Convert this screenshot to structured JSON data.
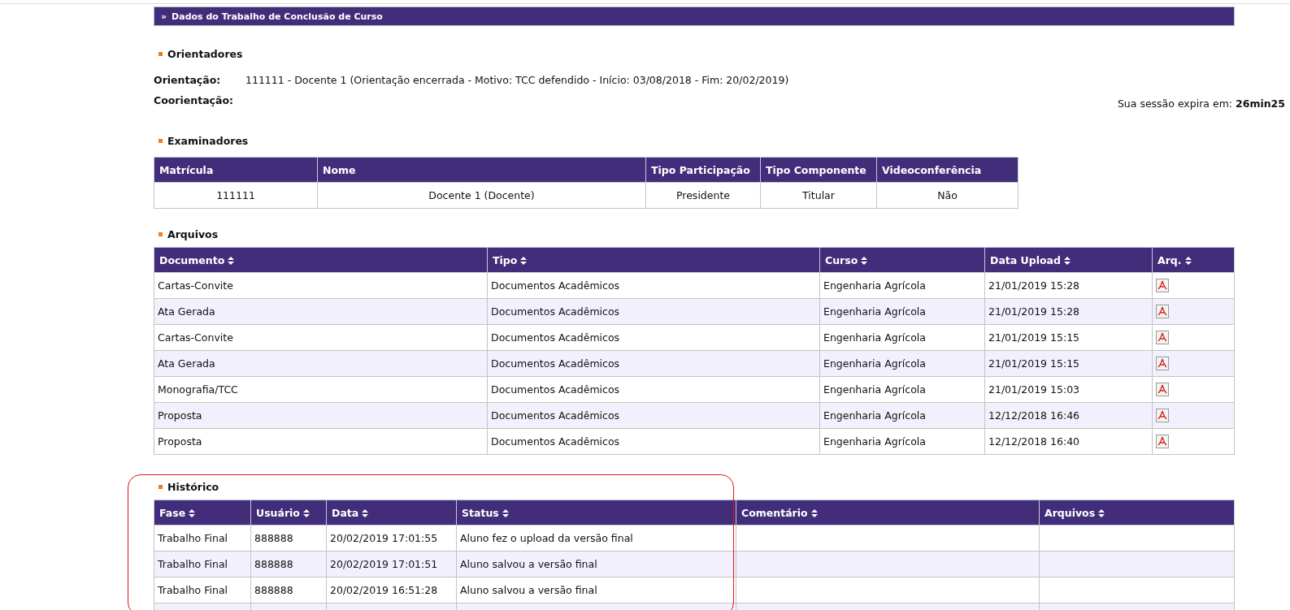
{
  "banner": {
    "marker": "»",
    "title": "Dados do Trabalho de Conclusão de Curso"
  },
  "session": {
    "text": "Sua sessão expira em: **26min25**"
  },
  "orientadores": {
    "title": "Orientadores",
    "fields": [
      {
        "label": "Orientação:",
        "value": "111111 - Docente 1 (Orientação encerrada - Motivo: TCC defendido - Início: 03/08/2018 - Fim: 20/02/2019)"
      },
      {
        "label": "Coorientação:"
      }
    ]
  },
  "examinadores": {
    "title": "Examinadores",
    "columns": [
      {
        "label": "Matrícula",
        "sortable": false
      },
      {
        "label": "Nome",
        "sortable": false
      },
      {
        "label": "Tipo Participação",
        "sortable": false
      },
      {
        "label": "Tipo Componente",
        "sortable": false
      },
      {
        "label": "Videoconferência",
        "sortable": false
      }
    ],
    "rows": [
      {
        "cells": [
          "111111",
          "Docente 1 (Docente)",
          "Presidente",
          "Titular",
          "Não"
        ]
      }
    ]
  },
  "arquivos": {
    "title": "Arquivos",
    "columns": [
      {
        "label": "Documento",
        "sortable": true
      },
      {
        "label": "Tipo",
        "sortable": true
      },
      {
        "label": "Curso",
        "sortable": true
      },
      {
        "label": "Data Upload",
        "sortable": true
      },
      {
        "label": "Arq.",
        "sortable": true
      }
    ],
    "rows": [
      {
        "cells": [
          "Cartas-Convite",
          "Documentos Acadêmicos",
          "Engenharia Agrícola",
          "21/01/2019 15:28"
        ],
        "has_file": true
      },
      {
        "cells": [
          "Ata Gerada",
          "Documentos Acadêmicos",
          "Engenharia Agrícola",
          "21/01/2019 15:28"
        ],
        "has_file": true
      },
      {
        "cells": [
          "Cartas-Convite",
          "Documentos Acadêmicos",
          "Engenharia Agrícola",
          "21/01/2019 15:15"
        ],
        "has_file": true
      },
      {
        "cells": [
          "Ata Gerada",
          "Documentos Acadêmicos",
          "Engenharia Agrícola",
          "21/01/2019 15:15"
        ],
        "has_file": true
      },
      {
        "cells": [
          "Monografia/TCC",
          "Documentos Acadêmicos",
          "Engenharia Agrícola",
          "21/01/2019 15:03"
        ],
        "has_file": true
      },
      {
        "cells": [
          "Proposta",
          "Documentos Acadêmicos",
          "Engenharia Agrícola",
          "12/12/2018 16:46"
        ],
        "has_file": true
      },
      {
        "cells": [
          "Proposta",
          "Documentos Acadêmicos",
          "Engenharia Agrícola",
          "12/12/2018 16:40"
        ],
        "has_file": true
      }
    ]
  },
  "historico": {
    "title": "Histórico",
    "highlighted": true,
    "columns": [
      {
        "label": "Fase",
        "sortable": true
      },
      {
        "label": "Usuário",
        "sortable": true
      },
      {
        "label": "Data",
        "sortable": true
      },
      {
        "label": "Status",
        "sortable": true
      },
      {
        "label": "Comentário",
        "sortable": true
      },
      {
        "label": "Arquivos",
        "sortable": true
      }
    ],
    "rows": [
      {
        "cells": [
          "Trabalho Final",
          "888888",
          "20/02/2019 17:01:55",
          "Aluno fez o upload da versão final"
        ]
      },
      {
        "cells": [
          "Trabalho Final",
          "888888",
          "20/02/2019 17:01:51",
          "Aluno salvou a versão final"
        ]
      },
      {
        "cells": [
          "Trabalho Final",
          "888888",
          "20/02/2019 16:51:28",
          "Aluno salvou a versão final"
        ]
      }
    ]
  }
}
